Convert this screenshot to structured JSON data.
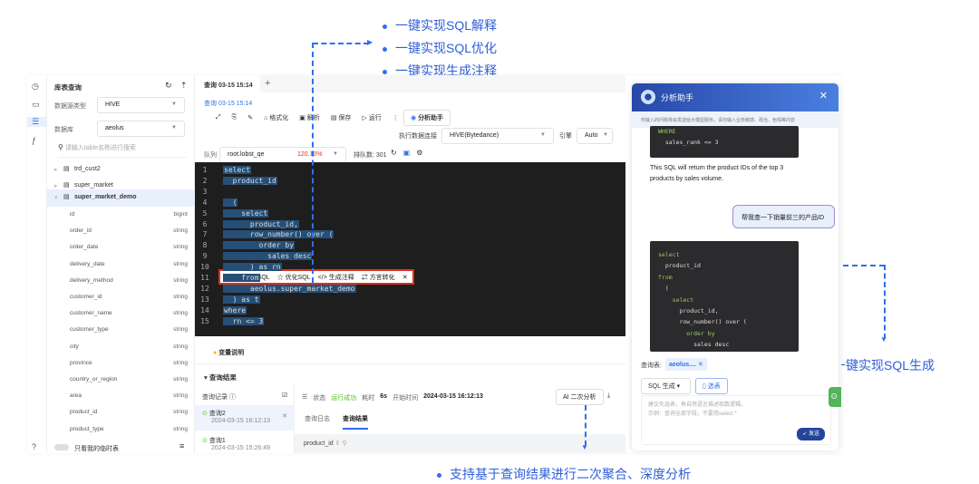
{
  "annotations": {
    "explain": "一键实现SQL解释",
    "optimize": "一键实现SQL优化",
    "comment": "一键实现生成注释",
    "generate": "一键实现SQL生成",
    "secondary": "支持基于查询结果进行二次聚合、深度分析"
  },
  "colors": {
    "accent": "#2f6ff0",
    "highlight_box": "#e0301e",
    "success": "#52c41a",
    "header_gradient_start": "#2848a8"
  },
  "left": {
    "title": "库表查询",
    "datasource_label": "数据源类型",
    "datasource_value": "HIVE",
    "db_label": "数据库",
    "db_value": "aeolus",
    "search_placeholder": "请输入table名称进行搜索",
    "tables": [
      "trd_cust2",
      "super_market",
      "super_market_demo"
    ],
    "columns": [
      {
        "name": "id",
        "type": "bigint"
      },
      {
        "name": "order_id",
        "type": "string"
      },
      {
        "name": "order_date",
        "type": "string"
      },
      {
        "name": "delivery_date",
        "type": "string"
      },
      {
        "name": "delivery_method",
        "type": "string"
      },
      {
        "name": "customer_id",
        "type": "string"
      },
      {
        "name": "customer_name",
        "type": "string"
      },
      {
        "name": "customer_type",
        "type": "string"
      },
      {
        "name": "city",
        "type": "string"
      },
      {
        "name": "province",
        "type": "string"
      },
      {
        "name": "country_or_region",
        "type": "string"
      },
      {
        "name": "area",
        "type": "string"
      },
      {
        "name": "product_id",
        "type": "string"
      },
      {
        "name": "product_type",
        "type": "string"
      }
    ],
    "temp_toggle": "只看我的临时表"
  },
  "editor": {
    "tab": "查询 03-15 15:14",
    "breadcrumb": "查询 03-15 15:14",
    "toolbar": {
      "format": "格式化",
      "parse": "解析",
      "save": "保存",
      "run": "运行",
      "assistant": "分析助手"
    },
    "conn_label": "执行数据连接",
    "conn_value": "HIVE(Bytedance)",
    "engine_label": "引擎",
    "engine_value": "Auto",
    "queue_label": "队列",
    "queue_value": "root.lobst_qe",
    "queue_pct": "120.10%",
    "queue_count": "排队数: 301",
    "popup": {
      "explain": "解释SQL",
      "optimize": "优化SQL",
      "comment": "生成注释",
      "dialect": "方言转化"
    },
    "lines": [
      "select",
      "  product_id",
      "from",
      "  (",
      "    select",
      "      product_id,",
      "      row_number() over (",
      "        order by",
      "          sales desc",
      "      ) as rn",
      "    from",
      "      aeolus.super_market_demo",
      "  ) as t",
      "where",
      "  rn <= 3"
    ]
  },
  "results": {
    "var_label": "变量说明",
    "title": "查询结果",
    "history_label": "查询记录",
    "history": [
      {
        "name": "查询2",
        "time": "2024-03-15 16:12:13"
      },
      {
        "name": "查询1",
        "time": "2024-03-15 15:26:49"
      }
    ],
    "status_label": "状态",
    "status_value": "运行成功",
    "duration_label": "耗时",
    "duration_value": "6s",
    "start_label": "开始时间",
    "start_value": "2024-03-15 16:12:13",
    "ai_button": "AI 二次分析",
    "tabs": [
      "查询日志",
      "查询结果"
    ],
    "column": "product_id"
  },
  "assistant": {
    "title": "分析助手",
    "notice": "你输入的问题将会发送给大模型服务，请勿输入业务敏感、政治、色情等内容",
    "code1": [
      "WHERE",
      "  sales_rank <= 3"
    ],
    "answer": "This SQL will return the product IDs of the top 3 products by sales volume.",
    "user_msg": "帮我查一下销量前三的产品ID",
    "code2": [
      "select",
      "  product_id",
      "from",
      "  (",
      "    select",
      "      product_id,",
      "      row_number() over (",
      "        order by",
      "          sales desc"
    ],
    "table_label": "查询表:",
    "table_tag": "aeolus....",
    "mode": "SQL 生成",
    "select_table": "选表",
    "placeholder1": "建议先选表，再自然语言描述取数逻辑。",
    "placeholder2": "示例：查询全部字段，不要用select *",
    "send": "发送"
  }
}
